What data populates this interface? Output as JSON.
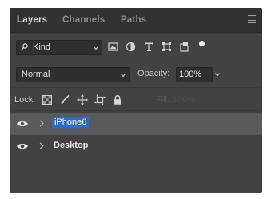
{
  "tabs": [
    {
      "label": "Layers",
      "active": true
    },
    {
      "label": "Channels",
      "active": false
    },
    {
      "label": "Paths",
      "active": false
    }
  ],
  "filter": {
    "kind_label": "Kind",
    "icons": [
      "pixel-filter-icon",
      "adjustment-filter-icon",
      "type-filter-icon",
      "shape-filter-icon",
      "smart-object-filter-icon",
      "filter-toggle-icon"
    ]
  },
  "blend": {
    "mode": "Normal",
    "opacity_label": "Opacity:",
    "opacity_value": "100%"
  },
  "lock": {
    "label": "Lock:",
    "fill_label": "Fill:",
    "fill_value": "100%"
  },
  "layers": [
    {
      "name": "iPhone6",
      "selected": true
    },
    {
      "name": "Desktop",
      "selected": false
    }
  ],
  "colors": {
    "panel_bg": "#424242",
    "tab_bar_bg": "#323232",
    "selection_highlight": "#2d6bc9"
  }
}
